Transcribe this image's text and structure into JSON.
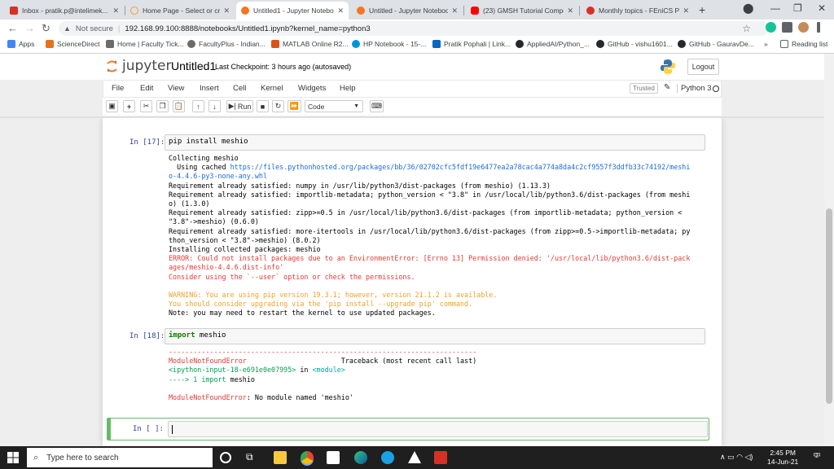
{
  "browser": {
    "tabs": [
      {
        "label": "Inbox - pratik.p@intelimek...",
        "color": "#d93025"
      },
      {
        "label": "Home Page - Select or crea...",
        "color": "#f0a030"
      },
      {
        "label": "Untitled1 - Jupyter Notebo...",
        "color": "#f37626"
      },
      {
        "label": "Untitled - Jupyter Notebook",
        "color": "#f37626"
      },
      {
        "label": "(23) GMSH Tutorial Compo...",
        "color": "#ff0000"
      },
      {
        "label": "Monthly topics - FEniCS Pro...",
        "color": "#d93025"
      }
    ],
    "new_tab": "+",
    "address": {
      "security": "Not secure",
      "url": "192.168.99.100:8888/notebooks/Untitled1.ipynb?kernel_name=python3"
    },
    "bookmarks": [
      {
        "label": "Apps",
        "color": "#4285f4"
      },
      {
        "label": "ScienceDirect",
        "color": "#e9711c"
      },
      {
        "label": "Home | Faculty Tick...",
        "color": "#6b6b6b"
      },
      {
        "label": "FacultyPlus - Indian...",
        "color": "#6b6b6b"
      },
      {
        "label": "MATLAB Online R2...",
        "color": "#d95319"
      },
      {
        "label": "HP Notebook - 15-...",
        "color": "#0096d6"
      },
      {
        "label": "Pratik Pophali | Link...",
        "color": "#0a66c2"
      },
      {
        "label": "AppliedAI/Python_...",
        "color": "#24292e"
      },
      {
        "label": "GitHub - vishu1601...",
        "color": "#24292e"
      },
      {
        "label": "GitHub - GauravDe...",
        "color": "#24292e"
      },
      {
        "label": "»",
        "color": ""
      },
      {
        "label": "Reading list",
        "color": "#5f6368"
      }
    ]
  },
  "jupyter": {
    "logo_text": "jupyter",
    "notebook_title": "Untitled1",
    "checkpoint": "Last Checkpoint: 3 hours ago",
    "autosave": "(autosaved)",
    "logout_label": "Logout",
    "menus": [
      "File",
      "Edit",
      "View",
      "Insert",
      "Cell",
      "Kernel",
      "Widgets",
      "Help"
    ],
    "trusted_label": "Trusted",
    "kernel_name": "Python 3",
    "toolbar": {
      "run_label": "Run",
      "cell_type": "Code"
    }
  },
  "cells": {
    "c17": {
      "prompt": "In [17]:",
      "code": "pip install meshio",
      "out_collecting": "Collecting meshio",
      "out_using_cached": "  Using cached ",
      "out_url_1": "https://files.pythonhosted.org/packages/bb/36/02702cfc5fdf19e6477ea2a78cac4a774a8da4c2cf9557f3ddfb33c74192/meshi",
      "out_url_2": "o-4.4.6-py3-none-any.whl",
      "out_req_1": "Requirement already satisfied: numpy in /usr/lib/python3/dist-packages (from meshio) (1.13.3)",
      "out_req_2a": "Requirement already satisfied: importlib-metadata; python_version < \"3.8\" in /usr/local/lib/python3.6/dist-packages (from meshi",
      "out_req_2b": "o) (1.3.0)",
      "out_req_3a": "Requirement already satisfied: zipp>=0.5 in /usr/local/lib/python3.6/dist-packages (from importlib-metadata; python_version <",
      "out_req_3b": "\"3.8\"->meshio) (0.6.0)",
      "out_req_4a": "Requirement already satisfied: more-itertools in /usr/local/lib/python3.6/dist-packages (from zipp>=0.5->importlib-metadata; py",
      "out_req_4b": "thon_version < \"3.8\"->meshio) (8.0.2)",
      "out_installing": "Installing collected packages: meshio",
      "out_err_1": "ERROR: Could not install packages due to an EnvironmentError: [Errno 13] Permission denied: '/usr/local/lib/python3.6/dist-pack",
      "out_err_2": "ages/meshio-4.4.6.dist-info'",
      "out_err_3": "Consider using the `--user` option or check the permissions.",
      "out_warn_1": "WARNING: You are using pip version 19.3.1; however, version 21.1.2 is available.",
      "out_warn_2": "You should consider upgrading via the 'pip install --upgrade pip' command.",
      "out_note": "Note: you may need to restart the kernel to use updated packages."
    },
    "c18": {
      "prompt": "In [18]:",
      "code_kw": "import",
      "code_rest": " meshio",
      "tb_dashes": "---------------------------------------------------------------------------",
      "tb_err": "ModuleNotFoundError",
      "tb_gap": "                       ",
      "tb_title": "Traceback (most recent call last)",
      "tb_input": "<ipython-input-18-e691e0e07995>",
      "tb_in": " in ",
      "tb_module": "<module>",
      "tb_arrow": "----> 1 ",
      "tb_line_kw": "import",
      "tb_line_rest": " meshio",
      "tb_final_err": "ModuleNotFoundError",
      "tb_final_msg": ": No module named 'meshio'"
    },
    "empty": {
      "prompt": "In [ ]:"
    }
  },
  "taskbar": {
    "search_placeholder": "Type here to search",
    "time": "2:45 PM",
    "date": "14-Jun-21",
    "notification_count": "2"
  }
}
